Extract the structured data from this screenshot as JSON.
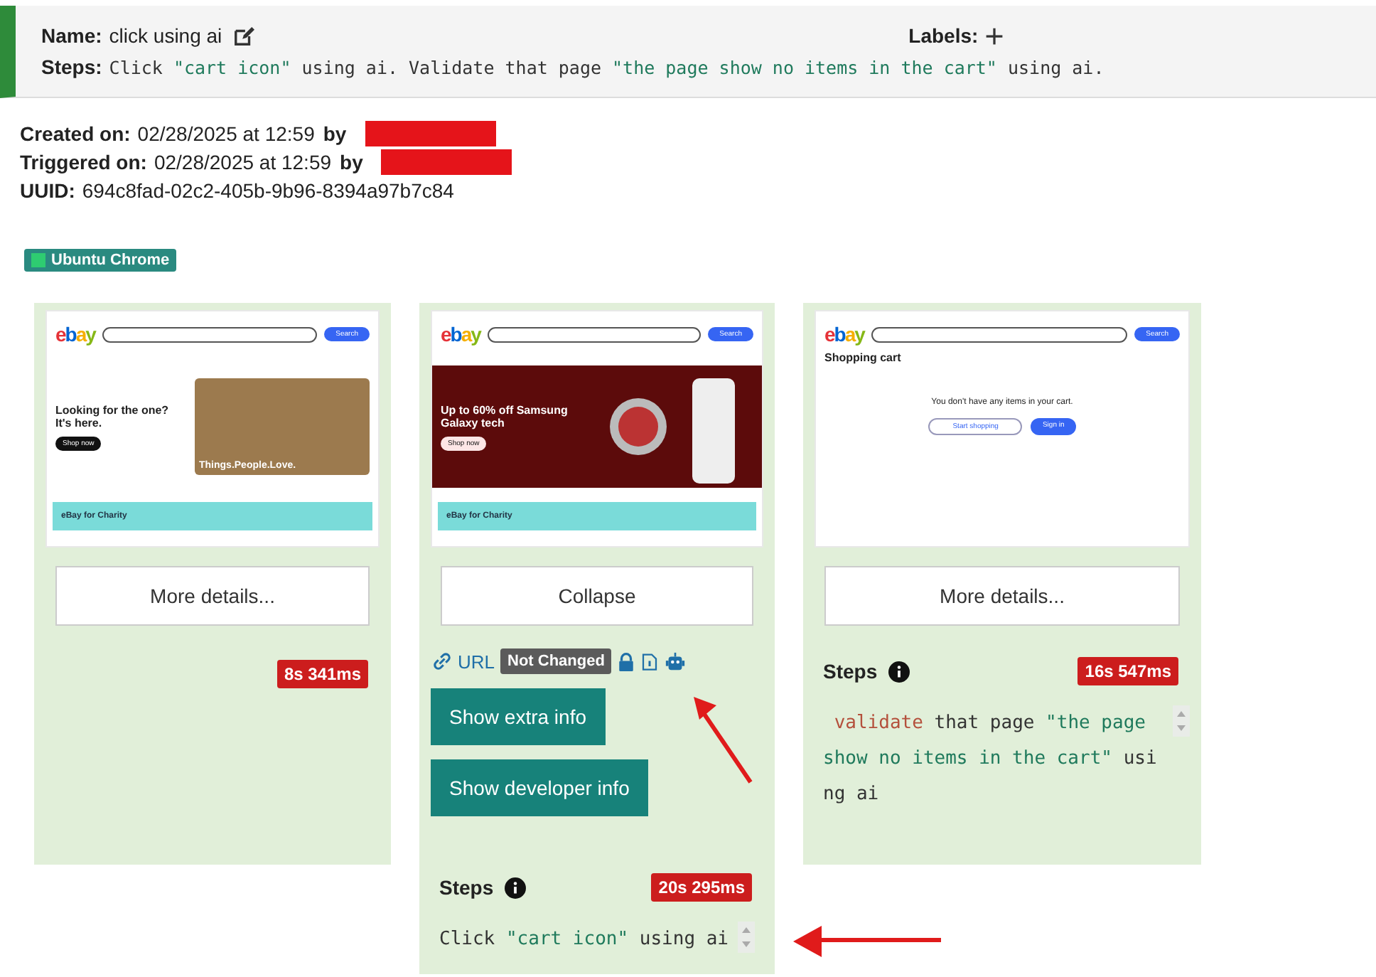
{
  "header": {
    "name_label": "Name:",
    "name": "click using ai",
    "labels_label": "Labels:",
    "steps_label": "Steps:",
    "steps": [
      {
        "kind": "plain",
        "text": "Click "
      },
      {
        "kind": "string",
        "text": "\"cart icon\""
      },
      {
        "kind": "plain",
        "text": " using ai. Validate that page "
      },
      {
        "kind": "string",
        "text": "\"the page show no items in the cart\""
      },
      {
        "kind": "plain",
        "text": " using ai."
      }
    ]
  },
  "info": [
    {
      "label": "Created on:",
      "value": "02/28/2025 at 12:59",
      "by": "by",
      "redacted": true
    },
    {
      "label": "Triggered on:",
      "value": "02/28/2025 at 12:59",
      "by": "by",
      "redacted": true
    },
    {
      "label": "UUID:",
      "value": "694c8fad-02c2-405b-9b96-8394a97b7c84"
    }
  ],
  "environment": {
    "label": "Ubuntu Chrome",
    "color": "#2ecc71"
  },
  "cards": [
    {
      "screenshot": {
        "kind": "home",
        "logo": "ebay",
        "search_button": "Search",
        "banner_title": "Looking for the one? It's here.",
        "banner_button": "Shop now",
        "photo_caption": "Things.People.Love.",
        "charity_title": "eBay for Charity"
      },
      "toggle": "More details...",
      "duration": "8s 341ms"
    },
    {
      "screenshot": {
        "kind": "promo",
        "logo": "ebay",
        "search_button": "Search",
        "banner_title": "Up to 60% off Samsung Galaxy tech",
        "banner_button": "Shop now",
        "charity_title": "eBay for Charity"
      },
      "toggle": "Collapse",
      "details": {
        "url_label": "URL",
        "status": "Not Changed",
        "buttons": [
          "Show extra info",
          "Show developer info"
        ]
      },
      "steps_title": "Steps",
      "duration": "20s 295ms",
      "code": [
        {
          "kind": "plain",
          "text": "Click "
        },
        {
          "kind": "string",
          "text": "\"cart icon\""
        },
        {
          "kind": "plain",
          "text": " using ai"
        }
      ]
    },
    {
      "screenshot": {
        "kind": "cart",
        "logo": "ebay",
        "search_button": "Search",
        "title": "Shopping cart",
        "message": "You don't have any items in your cart.",
        "secondary_button": "Start shopping",
        "primary_button": "Sign in"
      },
      "toggle": "More details...",
      "steps_title": "Steps",
      "duration": "16s 547ms",
      "code": [
        {
          "kind": "keyword",
          "text": " validate"
        },
        {
          "kind": "plain",
          "text": " that page "
        },
        {
          "kind": "string",
          "text": "\"the page show no items in the cart\""
        },
        {
          "kind": "plain",
          "text": " using ai"
        }
      ]
    }
  ]
}
